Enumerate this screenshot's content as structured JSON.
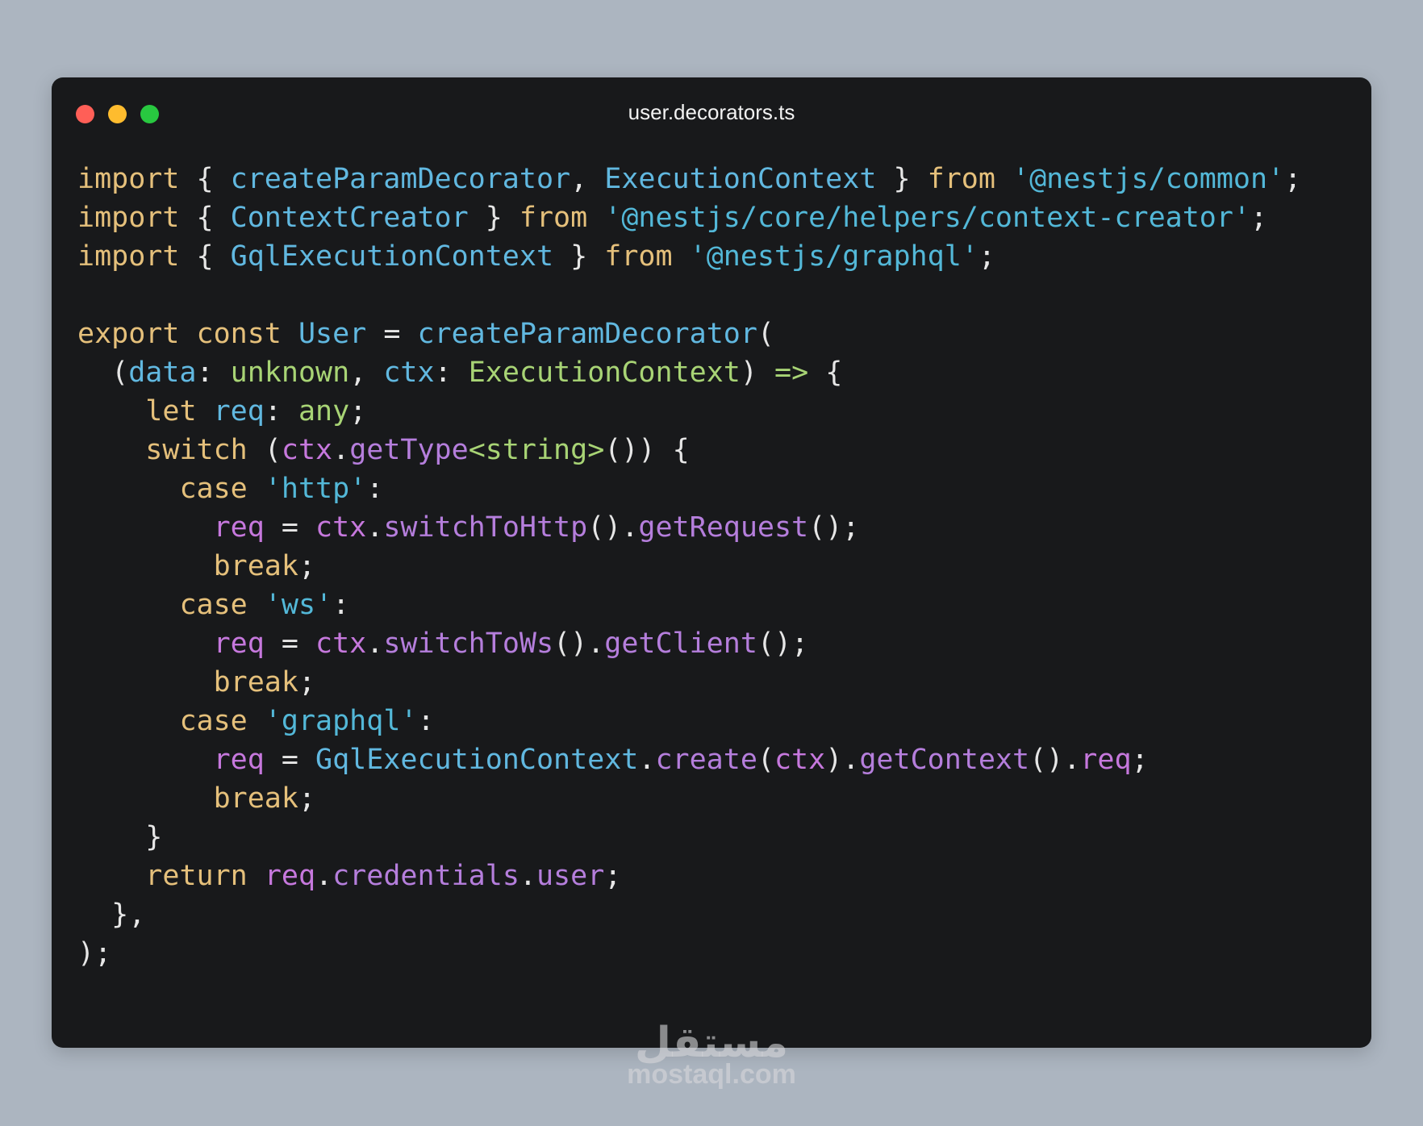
{
  "window": {
    "title": "user.decorators.ts",
    "controls": [
      "close",
      "minimize",
      "maximize"
    ]
  },
  "code_lines": [
    [
      [
        "kw",
        "import"
      ],
      [
        "punc",
        " { "
      ],
      [
        "id",
        "createParamDecorator"
      ],
      [
        "punc",
        ", "
      ],
      [
        "id",
        "ExecutionContext"
      ],
      [
        "punc",
        " } "
      ],
      [
        "kw",
        "from"
      ],
      [
        "punc",
        " "
      ],
      [
        "str",
        "'@nestjs/common'"
      ],
      [
        "punc",
        ";"
      ]
    ],
    [
      [
        "kw",
        "import"
      ],
      [
        "punc",
        " { "
      ],
      [
        "id",
        "ContextCreator"
      ],
      [
        "punc",
        " } "
      ],
      [
        "kw",
        "from"
      ],
      [
        "punc",
        " "
      ],
      [
        "str",
        "'@nestjs/core/helpers/context-creator'"
      ],
      [
        "punc",
        ";"
      ]
    ],
    [
      [
        "kw",
        "import"
      ],
      [
        "punc",
        " { "
      ],
      [
        "id",
        "GqlExecutionContext"
      ],
      [
        "punc",
        " } "
      ],
      [
        "kw",
        "from"
      ],
      [
        "punc",
        " "
      ],
      [
        "str",
        "'@nestjs/graphql'"
      ],
      [
        "punc",
        ";"
      ]
    ],
    [],
    [
      [
        "kw",
        "export"
      ],
      [
        "punc",
        " "
      ],
      [
        "kw",
        "const"
      ],
      [
        "punc",
        " "
      ],
      [
        "id",
        "User"
      ],
      [
        "punc",
        " = "
      ],
      [
        "id",
        "createParamDecorator"
      ],
      [
        "punc",
        "("
      ]
    ],
    [
      [
        "punc",
        "  ("
      ],
      [
        "id",
        "data"
      ],
      [
        "punc",
        ": "
      ],
      [
        "type",
        "unknown"
      ],
      [
        "punc",
        ", "
      ],
      [
        "id",
        "ctx"
      ],
      [
        "punc",
        ": "
      ],
      [
        "type",
        "ExecutionContext"
      ],
      [
        "punc",
        ") "
      ],
      [
        "type",
        "=>"
      ],
      [
        "punc",
        " {"
      ]
    ],
    [
      [
        "punc",
        "    "
      ],
      [
        "kw",
        "let"
      ],
      [
        "punc",
        " "
      ],
      [
        "id",
        "req"
      ],
      [
        "punc",
        ": "
      ],
      [
        "type",
        "any"
      ],
      [
        "punc",
        ";"
      ]
    ],
    [
      [
        "punc",
        "    "
      ],
      [
        "kw",
        "switch"
      ],
      [
        "punc",
        " ("
      ],
      [
        "var",
        "ctx"
      ],
      [
        "punc",
        "."
      ],
      [
        "fn",
        "getType"
      ],
      [
        "type",
        "<string>"
      ],
      [
        "punc",
        "()) {"
      ]
    ],
    [
      [
        "punc",
        "      "
      ],
      [
        "kw",
        "case"
      ],
      [
        "punc",
        " "
      ],
      [
        "str",
        "'http'"
      ],
      [
        "punc",
        ":"
      ]
    ],
    [
      [
        "punc",
        "        "
      ],
      [
        "var",
        "req"
      ],
      [
        "punc",
        " = "
      ],
      [
        "var",
        "ctx"
      ],
      [
        "punc",
        "."
      ],
      [
        "fn",
        "switchToHttp"
      ],
      [
        "punc",
        "()."
      ],
      [
        "fn",
        "getRequest"
      ],
      [
        "punc",
        "();"
      ]
    ],
    [
      [
        "punc",
        "        "
      ],
      [
        "kw",
        "break"
      ],
      [
        "punc",
        ";"
      ]
    ],
    [
      [
        "punc",
        "      "
      ],
      [
        "kw",
        "case"
      ],
      [
        "punc",
        " "
      ],
      [
        "str",
        "'ws'"
      ],
      [
        "punc",
        ":"
      ]
    ],
    [
      [
        "punc",
        "        "
      ],
      [
        "var",
        "req"
      ],
      [
        "punc",
        " = "
      ],
      [
        "var",
        "ctx"
      ],
      [
        "punc",
        "."
      ],
      [
        "fn",
        "switchToWs"
      ],
      [
        "punc",
        "()."
      ],
      [
        "fn",
        "getClient"
      ],
      [
        "punc",
        "();"
      ]
    ],
    [
      [
        "punc",
        "        "
      ],
      [
        "kw",
        "break"
      ],
      [
        "punc",
        ";"
      ]
    ],
    [
      [
        "punc",
        "      "
      ],
      [
        "kw",
        "case"
      ],
      [
        "punc",
        " "
      ],
      [
        "str",
        "'graphql'"
      ],
      [
        "punc",
        ":"
      ]
    ],
    [
      [
        "punc",
        "        "
      ],
      [
        "var",
        "req"
      ],
      [
        "punc",
        " = "
      ],
      [
        "id",
        "GqlExecutionContext"
      ],
      [
        "punc",
        "."
      ],
      [
        "fn",
        "create"
      ],
      [
        "punc",
        "("
      ],
      [
        "var",
        "ctx"
      ],
      [
        "punc",
        ")."
      ],
      [
        "fn",
        "getContext"
      ],
      [
        "punc",
        "()."
      ],
      [
        "var",
        "req"
      ],
      [
        "punc",
        ";"
      ]
    ],
    [
      [
        "punc",
        "        "
      ],
      [
        "kw",
        "break"
      ],
      [
        "punc",
        ";"
      ]
    ],
    [
      [
        "punc",
        "    }"
      ]
    ],
    [
      [
        "punc",
        "    "
      ],
      [
        "kw",
        "return"
      ],
      [
        "punc",
        " "
      ],
      [
        "var",
        "req"
      ],
      [
        "punc",
        "."
      ],
      [
        "fn",
        "credentials"
      ],
      [
        "punc",
        "."
      ],
      [
        "fn",
        "user"
      ],
      [
        "punc",
        ";"
      ]
    ],
    [
      [
        "punc",
        "  },"
      ]
    ],
    [
      [
        "punc",
        ");"
      ]
    ]
  ],
  "watermark": {
    "logo_text": "مستقل",
    "url": "mostaql.com"
  }
}
